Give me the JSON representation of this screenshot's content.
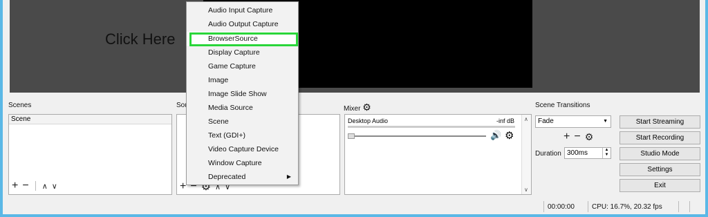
{
  "preview": {
    "overlay_text": "Click Here"
  },
  "docks": {
    "scenes_title": "Scenes",
    "sources_title_visible": "Sou",
    "mixer_title": "Mixer",
    "transitions_title": "Scene Transitions"
  },
  "scenes": {
    "items": [
      "Scene"
    ]
  },
  "context_menu": {
    "items": [
      "Audio Input Capture",
      "Audio Output Capture",
      "BrowserSource",
      "Display Capture",
      "Game Capture",
      "Image",
      "Image Slide Show",
      "Media Source",
      "Scene",
      "Text (GDI+)",
      "Video Capture Device",
      "Window Capture",
      "Deprecated"
    ],
    "highlighted": "BrowserSource"
  },
  "mixer": {
    "channel_name": "Desktop Audio",
    "level_text": "-inf dB",
    "volume_level": 0
  },
  "transitions": {
    "selected": "Fade",
    "duration_label": "Duration",
    "duration_value": "300ms"
  },
  "controls": {
    "start_streaming": "Start Streaming",
    "start_recording": "Start Recording",
    "studio_mode": "Studio Mode",
    "settings": "Settings",
    "exit": "Exit"
  },
  "status_bar": {
    "time": "00:00:00",
    "cpu": "CPU: 16.7%, 20.32 fps"
  },
  "colors": {
    "highlight_border": "#2ad63a",
    "window_border": "#5bb8e6",
    "preview_bg": "#4a4a4a"
  },
  "icons": [
    "plus-icon",
    "minus-icon",
    "chevron-up-icon",
    "chevron-down-icon",
    "gear-icon",
    "speaker-icon",
    "submenu-arrow-icon"
  ]
}
